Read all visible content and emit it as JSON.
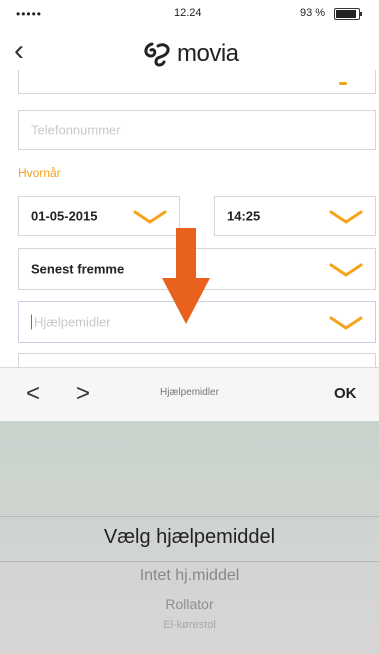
{
  "status_bar": {
    "signal": "•••••",
    "time": "12.24",
    "battery_text": "93 %",
    "battery_level_percent": 93
  },
  "nav": {
    "back_icon": "chevron-left-icon",
    "logo_text": "movia"
  },
  "form": {
    "phone_placeholder": "Telefonnummer",
    "when_label": "Hvornår",
    "date_value": "01-05-2015",
    "time_value": "14:25",
    "arrival_value": "Senest fremme",
    "aids_placeholder": "Hjælpemidler"
  },
  "toolbar": {
    "prev_label": "<",
    "next_label": ">",
    "title": "Hjælpemidler",
    "ok_label": "OK"
  },
  "picker": {
    "options": [
      "Vælg hjælpemiddel",
      "Intet hj.middel",
      "Rollator",
      "El-kørestol"
    ]
  },
  "colors": {
    "accent": "#f7a21b",
    "arrow": "#e8621e",
    "picker_bg": "#d3d6d3"
  }
}
